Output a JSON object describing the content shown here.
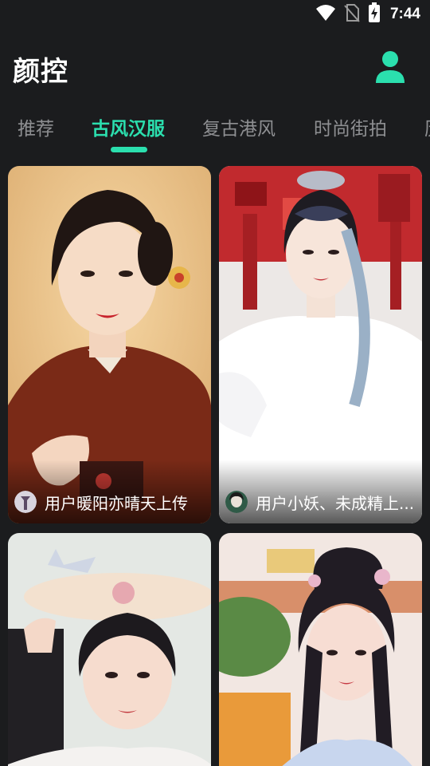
{
  "status_bar": {
    "time": "7:44",
    "icons": [
      "wifi-icon",
      "no-sim-icon",
      "battery-charging-icon"
    ]
  },
  "header": {
    "title": "颜控",
    "profile_icon": "person-icon"
  },
  "tabs": [
    {
      "label": "推荐",
      "active": false
    },
    {
      "label": "古风汉服",
      "active": true
    },
    {
      "label": "复古港风",
      "active": false
    },
    {
      "label": "时尚街拍",
      "active": false
    },
    {
      "label": "历",
      "active": false
    }
  ],
  "feed": {
    "cards": [
      {
        "uploader": "用户暖阳亦晴天上传"
      },
      {
        "uploader": "用户小妖、未成精上..."
      },
      {
        "uploader": ""
      },
      {
        "uploader": ""
      }
    ]
  },
  "colors": {
    "accent": "#2bdfae",
    "background": "#1b1c1e",
    "tab_inactive": "#8e8f92"
  }
}
